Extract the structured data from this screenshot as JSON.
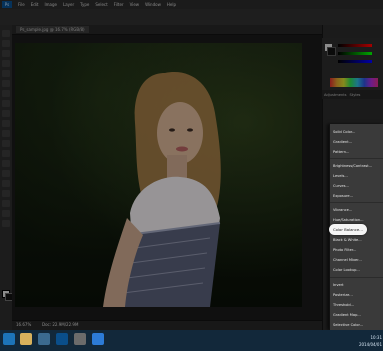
{
  "app": {
    "logo_text": "Ps",
    "menu_items": [
      "File",
      "Edit",
      "Image",
      "Layer",
      "Type",
      "Select",
      "Filter",
      "View",
      "Window",
      "Help"
    ]
  },
  "document": {
    "tab_label": "Ps_sample.jpg @ 16.7% (RGB/8)"
  },
  "status": {
    "zoom": "16.67%",
    "doc_info": "Doc: 22.9M/22.9M"
  },
  "adjustments_panel": {
    "tabs": [
      "Adjustments",
      "Styles"
    ],
    "menu_items": [
      "Solid Color...",
      "Gradient...",
      "Pattern...",
      "Brightness/Contrast...",
      "Levels...",
      "Curves...",
      "Exposure...",
      "Vibrance...",
      "Hue/Saturation...",
      "Color Balance...",
      "Black & White...",
      "Photo Filter...",
      "Channel Mixer...",
      "Color Lookup...",
      "Invert",
      "Posterize...",
      "Threshold...",
      "Gradient Map...",
      "Selective Color..."
    ],
    "highlighted_item": "Color Balance..."
  },
  "taskbar": {
    "time": "10:31",
    "date": "2014/04/01"
  },
  "colors": {
    "taskbar_bg": "#12283a",
    "ui_bg": "#2a2a2a",
    "highlight": "#ffffff"
  }
}
